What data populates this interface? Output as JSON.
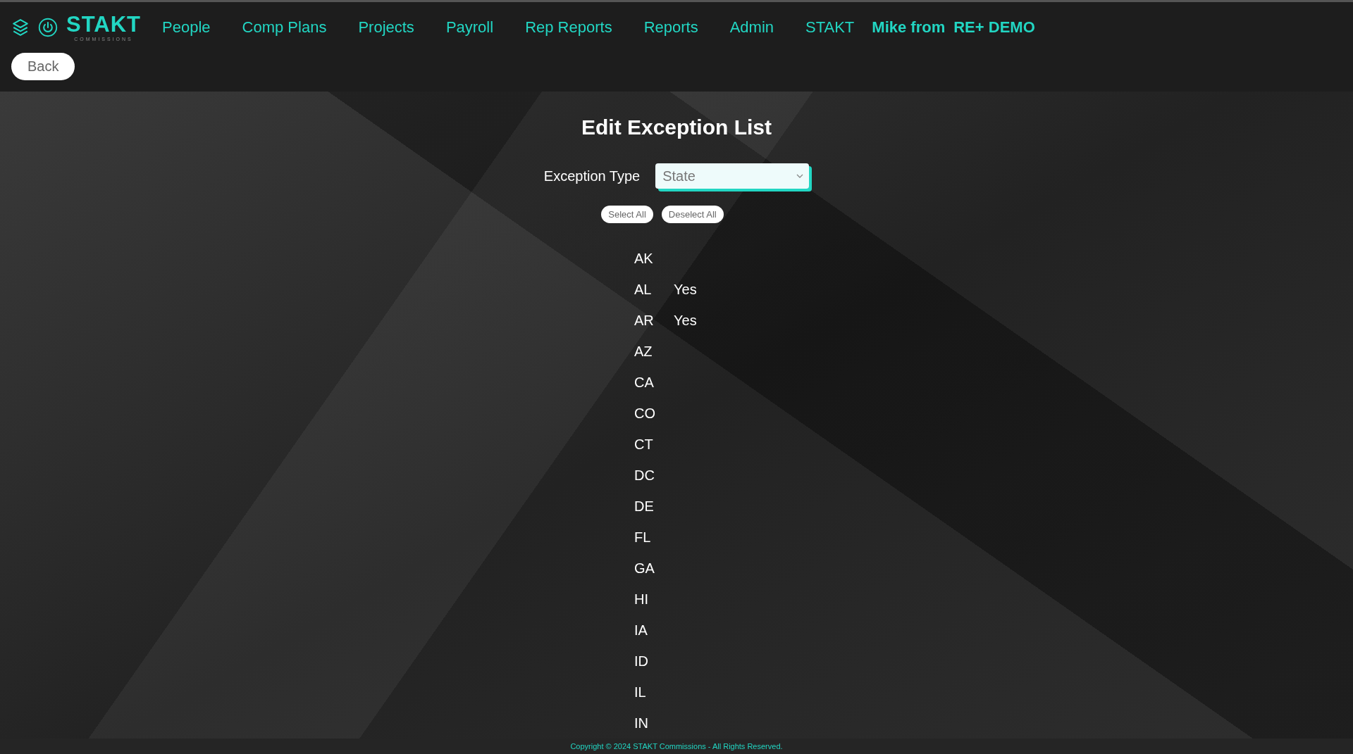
{
  "header": {
    "logo": {
      "name": "STAKT",
      "subtitle": "COMMISSIONS"
    },
    "nav": [
      {
        "label": "People"
      },
      {
        "label": "Comp Plans"
      },
      {
        "label": "Projects"
      },
      {
        "label": "Payroll"
      },
      {
        "label": "Rep Reports"
      },
      {
        "label": "Reports"
      },
      {
        "label": "Admin"
      },
      {
        "label": "STAKT"
      }
    ],
    "user": "Mike from",
    "company": "RE+ DEMO",
    "back_button": "Back"
  },
  "page": {
    "title": "Edit Exception List",
    "field": {
      "label": "Exception Type",
      "value": "State"
    },
    "buttons": [
      "Select All",
      "Deselect All"
    ],
    "rows": [
      {
        "code": "AK"
      },
      {
        "code": "AL",
        "value": "Yes"
      },
      {
        "code": "AR",
        "value": "Yes"
      },
      {
        "code": "AZ"
      },
      {
        "code": "CA"
      },
      {
        "code": "CO"
      },
      {
        "code": "CT"
      },
      {
        "code": "DC"
      },
      {
        "code": "DE"
      },
      {
        "code": "FL"
      },
      {
        "code": "GA"
      },
      {
        "code": "HI"
      },
      {
        "code": "IA"
      },
      {
        "code": "ID"
      },
      {
        "code": "IL"
      },
      {
        "code": "IN"
      }
    ]
  },
  "footer": "Copyright © 2024 STAKT Commissions - All Rights Reserved."
}
